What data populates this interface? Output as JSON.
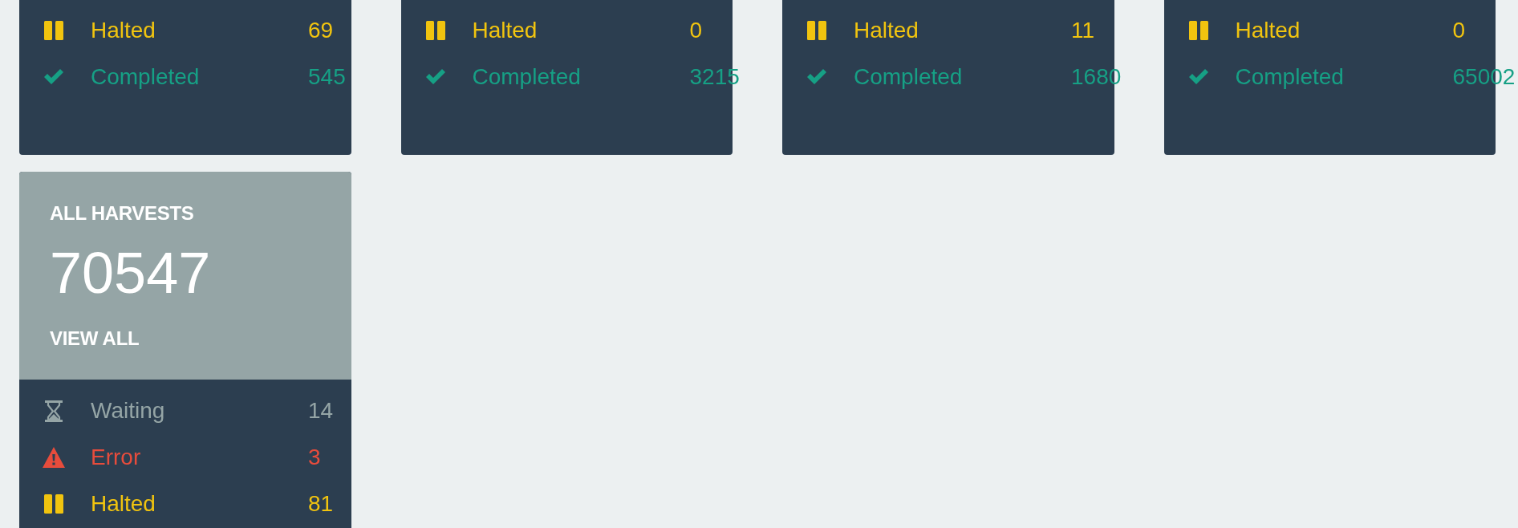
{
  "status_cards": [
    {
      "rows": [
        {
          "kind": "halted",
          "label": "Halted",
          "count": "69"
        },
        {
          "kind": "completed",
          "label": "Completed",
          "count": "545"
        }
      ]
    },
    {
      "rows": [
        {
          "kind": "halted",
          "label": "Halted",
          "count": "0"
        },
        {
          "kind": "completed",
          "label": "Completed",
          "count": "3215"
        }
      ]
    },
    {
      "rows": [
        {
          "kind": "halted",
          "label": "Halted",
          "count": "11"
        },
        {
          "kind": "completed",
          "label": "Completed",
          "count": "1680"
        }
      ]
    },
    {
      "rows": [
        {
          "kind": "halted",
          "label": "Halted",
          "count": "0"
        },
        {
          "kind": "completed",
          "label": "Completed",
          "count": "65002"
        }
      ]
    }
  ],
  "all_harvests_card": {
    "title": "ALL HARVESTS",
    "total": "70547",
    "link": "VIEW ALL",
    "rows": [
      {
        "kind": "waiting",
        "label": "Waiting",
        "count": "14"
      },
      {
        "kind": "error",
        "label": "Error",
        "count": "3"
      },
      {
        "kind": "halted",
        "label": "Halted",
        "count": "81"
      }
    ]
  }
}
